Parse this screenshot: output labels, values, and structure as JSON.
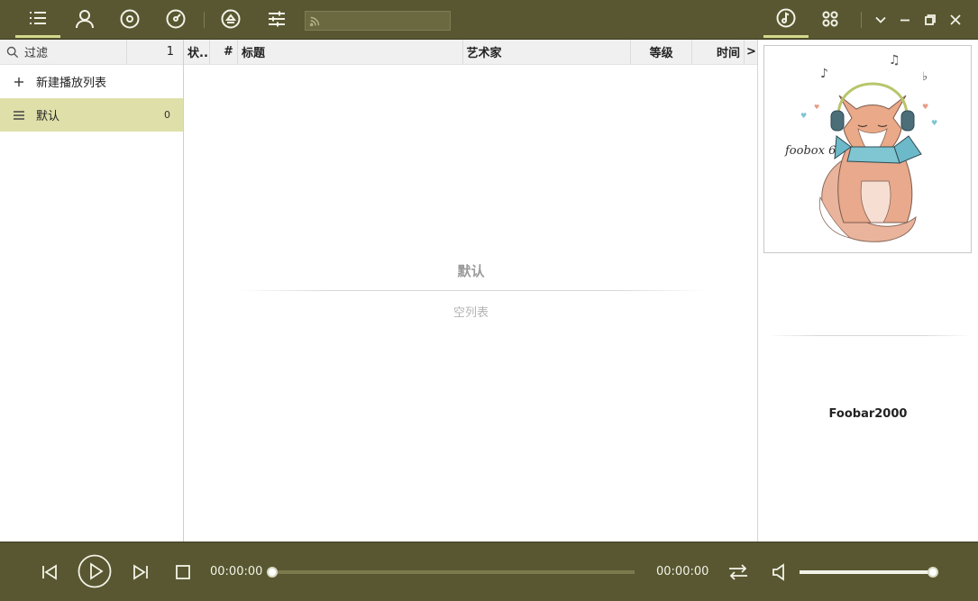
{
  "toolbar": {
    "left_icons": [
      "playlist-icon",
      "artist-icon",
      "album-icon",
      "genre-icon",
      "eject-icon",
      "equalizer-icon"
    ],
    "search_placeholder": "",
    "right_icons": [
      "music-note-icon",
      "apps-icon"
    ],
    "window_controls": [
      "chevron-down-icon",
      "minimize-icon",
      "restore-icon",
      "close-icon"
    ]
  },
  "sidebar": {
    "filter_label": "过滤",
    "filter_count": "1",
    "new_playlist_label": "新建播放列表",
    "items": [
      {
        "label": "默认",
        "count": "0"
      }
    ]
  },
  "playlist": {
    "columns": [
      "状...",
      "#",
      "标题",
      "艺术家",
      "等级",
      "时间",
      ">"
    ],
    "empty_title": "默认",
    "empty_subtitle": "空列表"
  },
  "right_panel": {
    "cover_caption": "foobox 6",
    "track_title": "Foobar2000"
  },
  "playback": {
    "elapsed": "00:00:00",
    "total": "00:00:00",
    "progress": 0,
    "volume": 1
  },
  "colors": {
    "bar_background": "#585731",
    "selected_item": "#dfe0a9",
    "active_indicator": "#d4d88c"
  }
}
